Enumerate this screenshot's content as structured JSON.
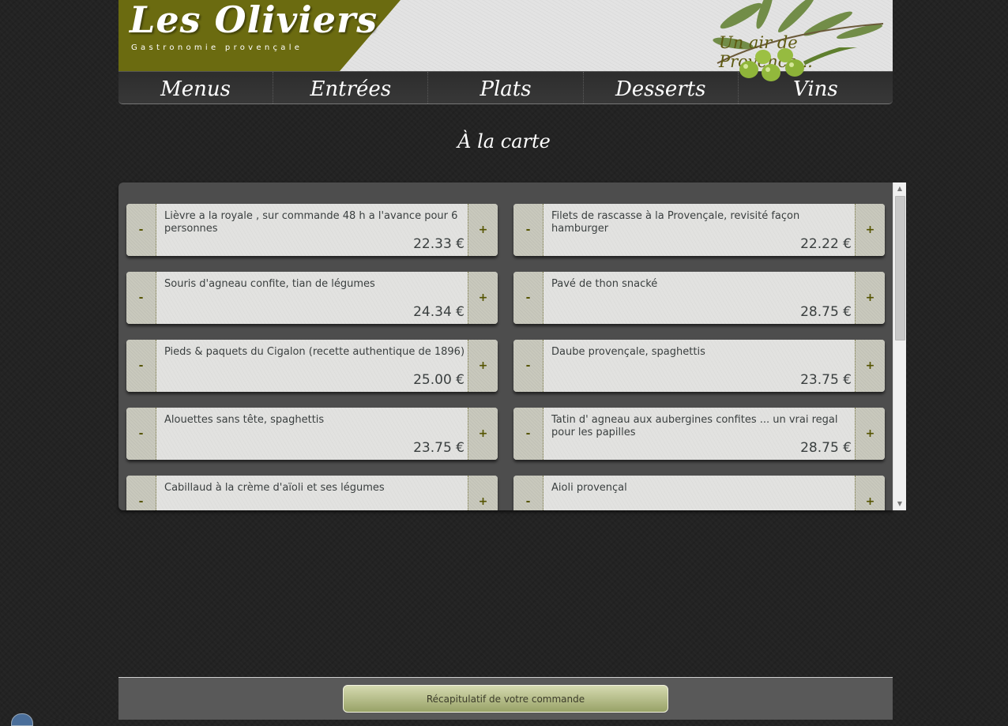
{
  "header": {
    "logo_title": "Les Oliviers",
    "logo_subtitle": "Gastronomie provençale",
    "tagline": "Un air de Provence...",
    "logo_color": "#6b6b10"
  },
  "nav": {
    "items": [
      {
        "label": "Menus"
      },
      {
        "label": "Entrées"
      },
      {
        "label": "Plats"
      },
      {
        "label": "Desserts"
      },
      {
        "label": "Vins"
      }
    ]
  },
  "main": {
    "title": "À la carte",
    "minus_label": "-",
    "plus_label": "+",
    "items": [
      {
        "name": "Lièvre a la royale , sur commande 48 h a l'avance pour 6 personnes",
        "price": "22.33 €"
      },
      {
        "name": "Filets de rascasse à la Provençale, revisité façon hamburger",
        "price": "22.22 €"
      },
      {
        "name": "Souris d'agneau confite, tian de légumes",
        "price": "24.34 €"
      },
      {
        "name": "Pavé de thon snacké",
        "price": "28.75 €"
      },
      {
        "name": "Pieds & paquets du Cigalon (recette authentique de 1896)",
        "price": "25.00 €"
      },
      {
        "name": "Daube provençale, spaghettis",
        "price": "23.75 €"
      },
      {
        "name": "Alouettes sans tête, spaghettis",
        "price": "23.75 €"
      },
      {
        "name": "Tatin d' agneau aux aubergines confites ... un vrai regal pour les papilles",
        "price": "28.75 €"
      },
      {
        "name": "Cabillaud à la crème d'aïoli et ses légumes",
        "price": ""
      },
      {
        "name": "Aioli provençal",
        "price": ""
      }
    ]
  },
  "footer": {
    "summary_label": "Récapitulatif de votre commande"
  }
}
